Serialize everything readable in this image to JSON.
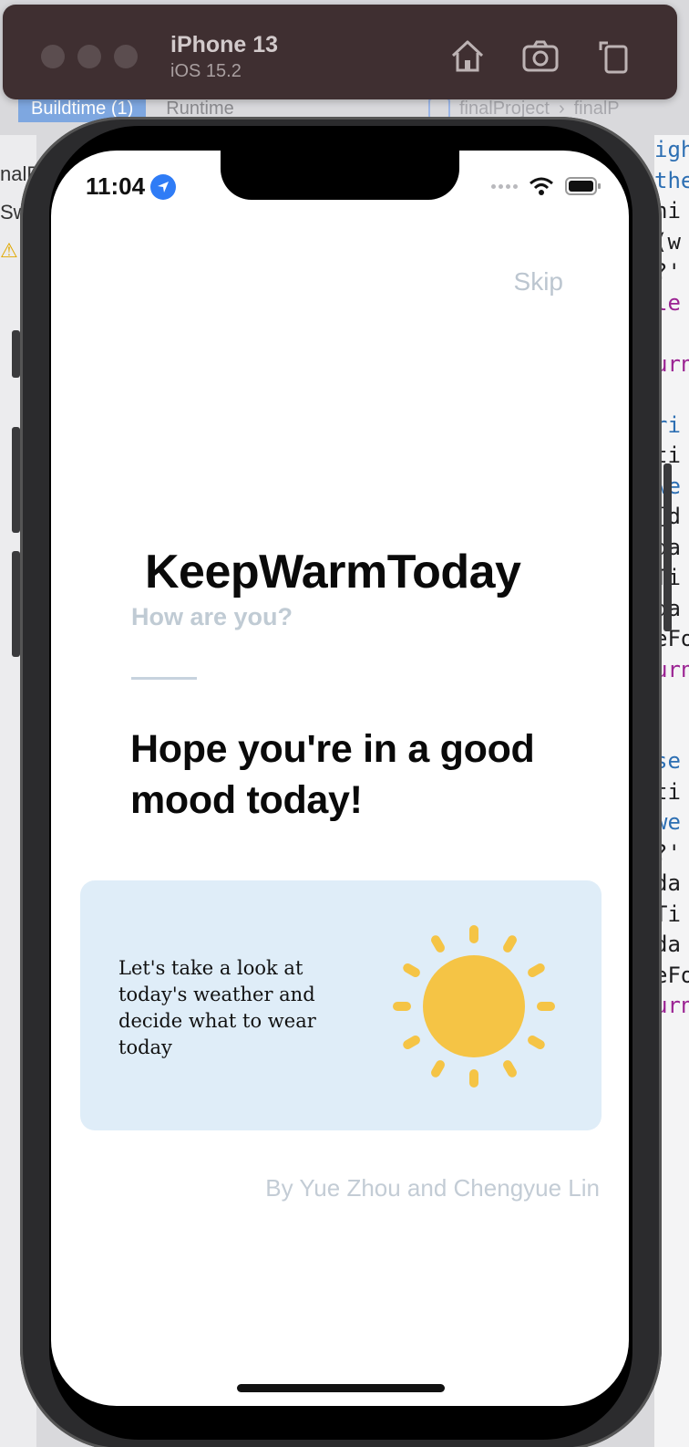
{
  "simulator": {
    "device_name": "iPhone 13",
    "os_version": "iOS 15.2"
  },
  "xcode": {
    "tab_active": "Buildtime (1)",
    "tab_inactive": "Runtime",
    "breadcrumb_project": "finalProject",
    "breadcrumb_folder": "finalP",
    "left_fragments": [
      "nalP",
      "Sw"
    ],
    "code_fragments": [
      "igh_t",
      "the",
      "hi",
      "(w",
      "?'",
      "le",
      "",
      "urn",
      "",
      "ri",
      "ti",
      "we",
      "[d",
      "da",
      "Ti",
      "da",
      "eFo",
      "urn",
      "",
      "",
      "se",
      "ti",
      "we",
      "?'",
      "da",
      "Ti",
      "da",
      "eFo",
      "urn"
    ]
  },
  "status_bar": {
    "time": "11:04"
  },
  "app": {
    "skip_label": "Skip",
    "title": "KeepWarmToday",
    "subtitle": "How are you?",
    "mood_message": "Hope you're in a good mood today!",
    "card_text": "Let's take a look at today's weather and decide what to wear today",
    "credit": "By Yue Zhou and Chengyue Lin"
  },
  "colors": {
    "accent_sun": "#f5c445",
    "card_background": "#dfedf8",
    "muted_text": "#c0cbd4"
  },
  "icons": {
    "location": "location-arrow-icon",
    "home": "home-icon",
    "screenshot": "camera-icon",
    "rotate": "rotate-icon",
    "weather": "sun-icon"
  }
}
